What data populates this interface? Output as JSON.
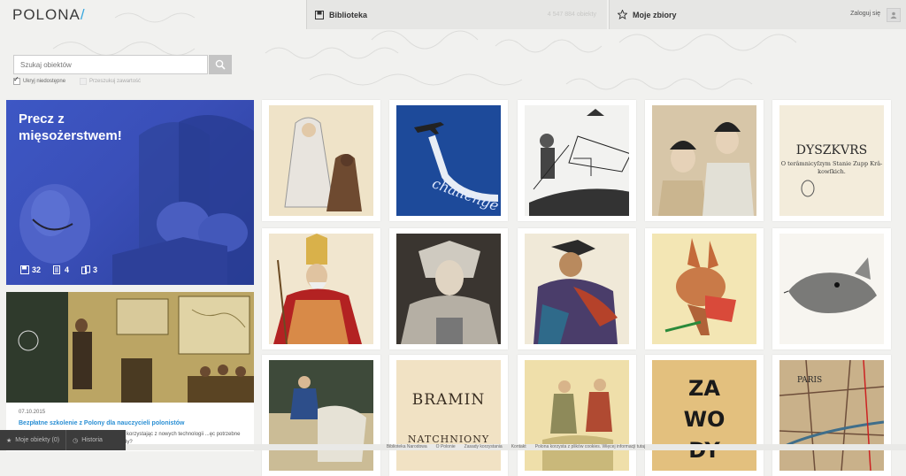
{
  "header": {
    "logo": "POLONA",
    "tabs": [
      {
        "label": "Biblioteka",
        "count": "4 547 884 obiekty"
      },
      {
        "label": "Moje zbiory"
      }
    ],
    "login": "Zaloguj się"
  },
  "search": {
    "placeholder": "Szukaj obiektów",
    "options": [
      {
        "label": "Ukryj niedostępne",
        "checked": true
      },
      {
        "label": "Przeszukuj zawartość",
        "checked": false
      }
    ]
  },
  "promo": {
    "title_line1": "Precz z",
    "title_line2": "mięsożerstwem!",
    "stats": [
      "32",
      "4",
      "3"
    ]
  },
  "news": {
    "date": "07.10.2015",
    "title": "Bezpłatne szkolenie z Polony dla nauczycieli polonistów",
    "text": "...? Jak korzystając z nowych technologii ...ęc potrzebne materiały?"
  },
  "tiles": {
    "t3_text": "challenge",
    "t5_title": "DYSZKVRS",
    "t5_sub": "O terâmnicyſzym Stanie Zupp Krâ-",
    "t5_sub2": "kowſkich.",
    "t13_line1": "BRAMIN",
    "t13_line2": "NATCHNIONY",
    "t15_line1": "ZA",
    "t15_line2": "WO",
    "t15_line3": "DY",
    "t16_text": "PARIS"
  },
  "bottom": {
    "my_objects": "Moje obiekty (0)",
    "history": "Historia"
  },
  "footer": [
    "Biblioteka Narodowa",
    "O Polonie",
    "Zasady korzystania",
    "Kontakt",
    "Polona korzysta z plików cookies. Więcej informacji tutaj"
  ],
  "colors": {
    "accent": "#37a6de",
    "promo_bg": "#3d57c4",
    "link": "#2a8fd4"
  }
}
